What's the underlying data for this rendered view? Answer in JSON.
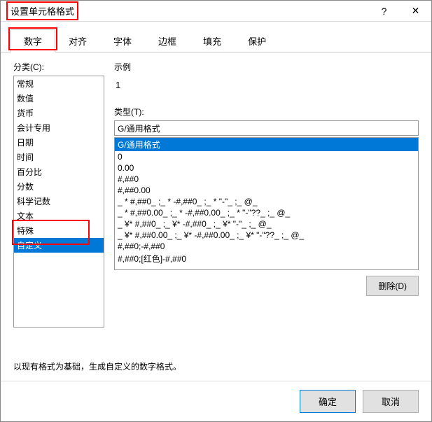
{
  "titlebar": {
    "title": "设置单元格格式",
    "help": "?",
    "close": "✕"
  },
  "tabs": {
    "number": "数字",
    "align": "对齐",
    "font": "字体",
    "border": "边框",
    "fill": "填充",
    "protect": "保护"
  },
  "left": {
    "label": "分类(C):",
    "items": [
      "常规",
      "数值",
      "货币",
      "会计专用",
      "日期",
      "时间",
      "百分比",
      "分数",
      "科学记数",
      "文本",
      "特殊",
      "自定义"
    ]
  },
  "right": {
    "sample_label": "示例",
    "sample_value": "1",
    "type_label": "类型(T):",
    "type_value": "G/通用格式",
    "formats": [
      "G/通用格式",
      "0",
      "0.00",
      "#,##0",
      "#,##0.00",
      "_ * #,##0_ ;_ * -#,##0_ ;_ * \"-\"_ ;_ @_ ",
      "_ * #,##0.00_ ;_ * -#,##0.00_ ;_ * \"-\"??_ ;_ @_ ",
      "_ ¥* #,##0_ ;_ ¥* -#,##0_ ;_ ¥* \"-\"_ ;_ @_ ",
      "_ ¥* #,##0.00_ ;_ ¥* -#,##0.00_ ;_ ¥* \"-\"??_ ;_ @_ ",
      "#,##0;-#,##0",
      "#,##0;[红色]-#,##0"
    ],
    "delete": "删除(D)",
    "note": "以现有格式为基础，生成自定义的数字格式。"
  },
  "footer": {
    "ok": "确定",
    "cancel": "取消"
  }
}
